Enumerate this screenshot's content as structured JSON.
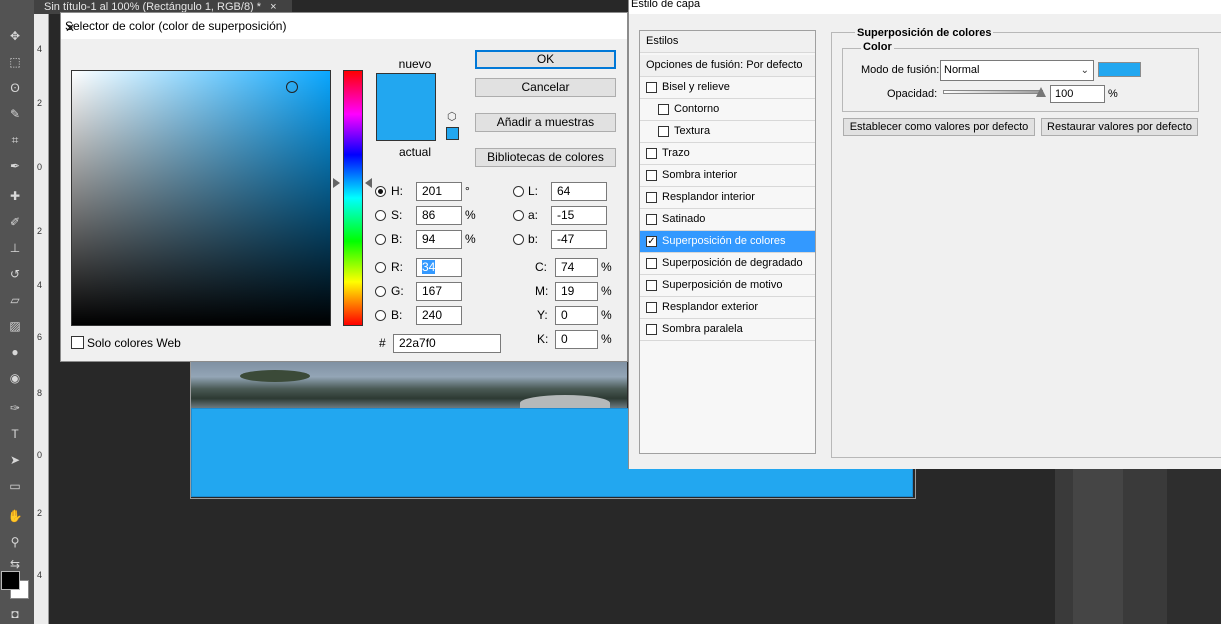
{
  "document": {
    "tab_title": "Sin título-1 al 100% (Rectángulo 1, RGB/8) *",
    "tab_close": "×"
  },
  "ruler": {
    "ticks": [
      "4",
      "2",
      "0",
      "2",
      "4",
      "6",
      "8",
      "0",
      "2",
      "4"
    ]
  },
  "toolbar": {
    "tools": [
      {
        "name": "move-tool-icon",
        "glyph": "✥"
      },
      {
        "name": "marquee-tool-icon",
        "glyph": "⬚"
      },
      {
        "name": "lasso-tool-icon",
        "glyph": "ʘ"
      },
      {
        "name": "quick-select-tool-icon",
        "glyph": "✎"
      },
      {
        "name": "crop-tool-icon",
        "glyph": "⌗"
      },
      {
        "name": "eyedropper-tool-icon",
        "glyph": "✒"
      },
      {
        "name": "healing-brush-tool-icon",
        "glyph": "✚"
      },
      {
        "name": "brush-tool-icon",
        "glyph": "✐"
      },
      {
        "name": "clone-stamp-tool-icon",
        "glyph": "⊥"
      },
      {
        "name": "history-brush-tool-icon",
        "glyph": "↺"
      },
      {
        "name": "eraser-tool-icon",
        "glyph": "▱"
      },
      {
        "name": "gradient-tool-icon",
        "glyph": "▨"
      },
      {
        "name": "blur-tool-icon",
        "glyph": "●"
      },
      {
        "name": "dodge-tool-icon",
        "glyph": "◉"
      },
      {
        "name": "pen-tool-icon",
        "glyph": "✑"
      },
      {
        "name": "type-tool-icon",
        "glyph": "T"
      },
      {
        "name": "path-select-tool-icon",
        "glyph": "➤"
      },
      {
        "name": "shape-tool-icon",
        "glyph": "▭"
      },
      {
        "name": "hand-tool-icon",
        "glyph": "✋"
      },
      {
        "name": "zoom-tool-icon",
        "glyph": "⚲"
      },
      {
        "name": "swap-colors-icon",
        "glyph": "⇆"
      },
      {
        "name": "quick-mask-icon",
        "glyph": "◘"
      }
    ],
    "foreground_color": "#000000",
    "background_color": "#ffffff"
  },
  "color_picker": {
    "title": "Selector de color (color de superposición)",
    "close_glyph": "✕",
    "label_new": "nuevo",
    "label_current": "actual",
    "new_color": "#22a7f0",
    "current_color": "#22a7f0",
    "cube_glyph": "⬡",
    "buttons": {
      "ok": "OK",
      "cancel": "Cancelar",
      "add_swatches": "Añadir a muestras",
      "libraries": "Bibliotecas de colores"
    },
    "fields": {
      "H": {
        "label": "H:",
        "value": "201",
        "unit": "°"
      },
      "S": {
        "label": "S:",
        "value": "86",
        "unit": "%"
      },
      "B": {
        "label": "B:",
        "value": "94",
        "unit": "%"
      },
      "R": {
        "label": "R:",
        "value": "34"
      },
      "G": {
        "label": "G:",
        "value": "167"
      },
      "Bl": {
        "label": "B:",
        "value": "240"
      },
      "L": {
        "label": "L:",
        "value": "64"
      },
      "a": {
        "label": "a:",
        "value": "-15"
      },
      "b": {
        "label": "b:",
        "value": "-47"
      },
      "C": {
        "label": "C:",
        "value": "74",
        "unit": "%"
      },
      "M": {
        "label": "M:",
        "value": "19",
        "unit": "%"
      },
      "Y": {
        "label": "Y:",
        "value": "0",
        "unit": "%"
      },
      "K": {
        "label": "K:",
        "value": "0",
        "unit": "%"
      }
    },
    "hex_label": "#",
    "hex_value": "22a7f0",
    "websafe_label": "Solo colores Web"
  },
  "layer_style": {
    "title": "Estilo de capa",
    "styles_header": "Estilos",
    "blend_options": "Opciones de fusión: Por defecto",
    "items": [
      {
        "label": "Bisel y relieve",
        "checked": false,
        "indent": false,
        "active": false
      },
      {
        "label": "Contorno",
        "checked": false,
        "indent": true,
        "active": false
      },
      {
        "label": "Textura",
        "checked": false,
        "indent": true,
        "active": false
      },
      {
        "label": "Trazo",
        "checked": false,
        "indent": false,
        "active": false
      },
      {
        "label": "Sombra interior",
        "checked": false,
        "indent": false,
        "active": false
      },
      {
        "label": "Resplandor interior",
        "checked": false,
        "indent": false,
        "active": false
      },
      {
        "label": "Satinado",
        "checked": false,
        "indent": false,
        "active": false
      },
      {
        "label": "Superposición de colores",
        "checked": true,
        "indent": false,
        "active": true
      },
      {
        "label": "Superposición de degradado",
        "checked": false,
        "indent": false,
        "active": false
      },
      {
        "label": "Superposición de motivo",
        "checked": false,
        "indent": false,
        "active": false
      },
      {
        "label": "Resplandor exterior",
        "checked": false,
        "indent": false,
        "active": false
      },
      {
        "label": "Sombra paralela",
        "checked": false,
        "indent": false,
        "active": false
      }
    ],
    "check_glyph": "✓",
    "panel_title": "Superposición de colores",
    "group_title": "Color",
    "blend_mode_label": "Modo de fusión:",
    "blend_mode_value": "Normal",
    "blend_chevron": "⌄",
    "overlay_color": "#22a7f0",
    "opacity_label": "Opacidad:",
    "opacity_value": "100",
    "opacity_unit": "%",
    "btn_set_default": "Establecer como valores por defecto",
    "btn_restore_default": "Restaurar valores por defecto"
  },
  "colors": {
    "accent_blue": "#22a7f0",
    "selection": "#3399ff",
    "ok_border": "#0078d7"
  }
}
